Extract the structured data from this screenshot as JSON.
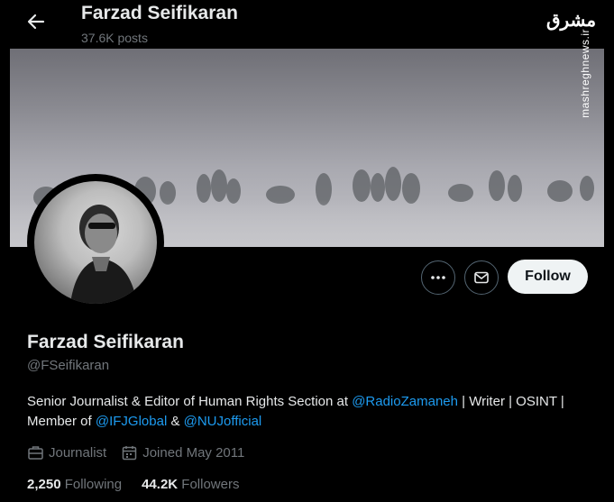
{
  "header": {
    "title": "Farzad Seifikaran",
    "posts_count": "37.6K posts"
  },
  "watermark": {
    "logo": "مشرق",
    "url": "mashreghnews.ir"
  },
  "actions": {
    "follow_label": "Follow"
  },
  "profile": {
    "display_name": "Farzad Seifikaran",
    "handle": "@FSeifikaran",
    "bio": {
      "part1": "Senior Journalist & Editor of Human Rights Section at ",
      "mention1": "@RadioZamaneh",
      "part2": " | Writer | OSINT | Member of ",
      "mention2": "@IFJGlobal",
      "part3": " & ",
      "mention3": "@NUJofficial"
    },
    "profession": "Journalist",
    "joined": "Joined May 2011"
  },
  "stats": {
    "following_count": "2,250",
    "following_label": "Following",
    "followers_count": "44.2K",
    "followers_label": "Followers"
  },
  "icons": [
    "back-arrow-icon",
    "more-icon",
    "mail-icon",
    "briefcase-icon",
    "calendar-icon"
  ],
  "colors": {
    "background": "#000000",
    "text": "#e7e9ea",
    "muted": "#71767b",
    "link": "#1d9bf0",
    "follow_bg": "#eff3f4"
  }
}
